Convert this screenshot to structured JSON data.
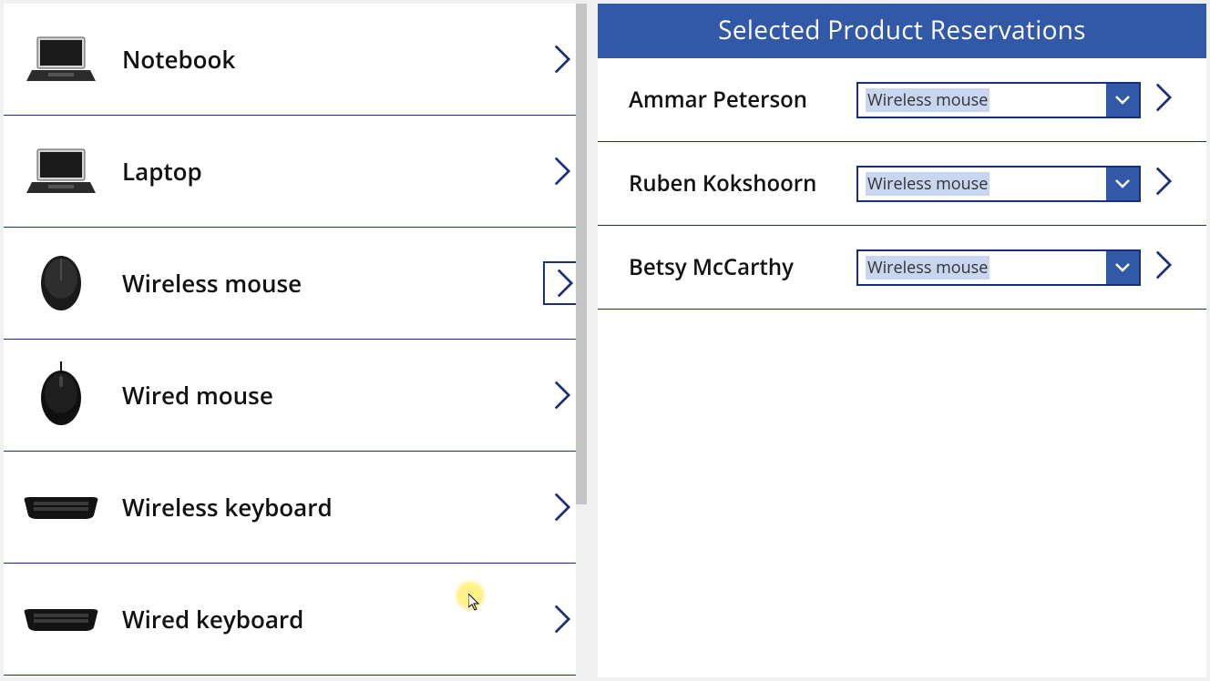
{
  "products": [
    {
      "label": "Notebook",
      "icon": "laptop-open",
      "selected": false
    },
    {
      "label": "Laptop",
      "icon": "laptop-open",
      "selected": false
    },
    {
      "label": "Wireless mouse",
      "icon": "mouse-wireless",
      "selected": true
    },
    {
      "label": "Wired mouse",
      "icon": "mouse-wired",
      "selected": false
    },
    {
      "label": "Wireless keyboard",
      "icon": "keyboard",
      "selected": false
    },
    {
      "label": "Wired keyboard",
      "icon": "keyboard",
      "selected": false
    }
  ],
  "right_panel": {
    "header": "Selected Product Reservations",
    "reservations": [
      {
        "name": "Ammar Peterson",
        "selected_product": "Wireless mouse"
      },
      {
        "name": "Ruben Kokshoorn",
        "selected_product": "Wireless mouse"
      },
      {
        "name": "Betsy McCarthy",
        "selected_product": "Wireless mouse"
      }
    ]
  },
  "colors": {
    "primary": "#3258a8",
    "border": "#1a2f7a",
    "highlight": "#c9d6ef"
  }
}
